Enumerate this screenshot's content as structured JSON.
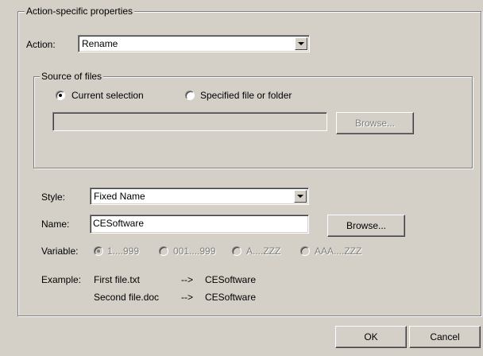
{
  "action_group": {
    "legend": "Action-specific properties",
    "action_label": "Action:",
    "action_value": "Rename"
  },
  "source_group": {
    "legend": "Source of files",
    "radio_current": {
      "label": "Current selection",
      "selected": true
    },
    "radio_specified": {
      "label": "Specified file or folder",
      "selected": false
    },
    "path_value": "",
    "browse_label": "Browse..."
  },
  "style": {
    "label": "Style:",
    "value": "Fixed Name"
  },
  "name": {
    "label": "Name:",
    "value": "CESoftware",
    "browse_label": "Browse..."
  },
  "variable": {
    "label": "Variable:",
    "options": [
      "1....999",
      "001....999",
      "A....ZZZ",
      "AAA....ZZZ"
    ]
  },
  "example": {
    "label": "Example:",
    "rows": [
      {
        "from": "First file.txt",
        "arrow": "-->",
        "to": "CESoftware"
      },
      {
        "from": "Second file.doc",
        "arrow": "-->",
        "to": "CESoftware"
      }
    ]
  },
  "buttons": {
    "ok": "OK",
    "cancel": "Cancel"
  }
}
